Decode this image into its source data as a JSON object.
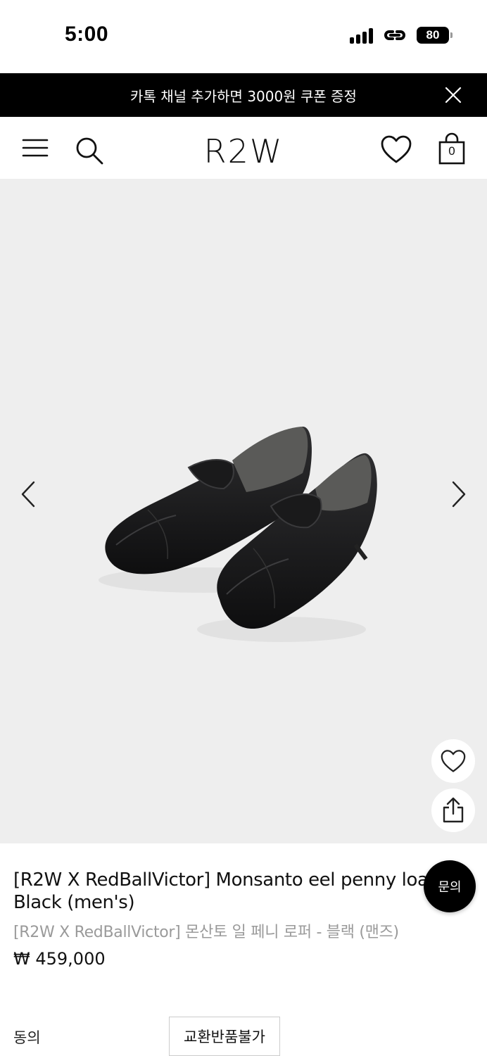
{
  "status_bar": {
    "time": "5:00",
    "battery": "80"
  },
  "promo": {
    "text": "카톡 채널 추가하면 3000원 쿠폰 증정"
  },
  "header": {
    "logo": "R2W",
    "cart_count": "0"
  },
  "product": {
    "title_en": "[R2W X RedBallVictor] Monsanto eel penny loafer - Black (men's)",
    "title_en_line1": "[R2W X RedBallVictor] Monsanto eel penny loa",
    "title_en_line2": "Black (men's)",
    "title_ko": "[R2W X RedBallVictor] 몬산토 일 페니 로퍼 - 블랙 (맨즈)",
    "price": "₩ 459,000"
  },
  "agreement": {
    "label": "동의",
    "button": "교환반품불가"
  },
  "inquiry_button": "문의",
  "colors": {
    "banner_bg": "#000000",
    "gallery_bg": "#eeeeee",
    "secondary_text": "#9a9a9a"
  }
}
